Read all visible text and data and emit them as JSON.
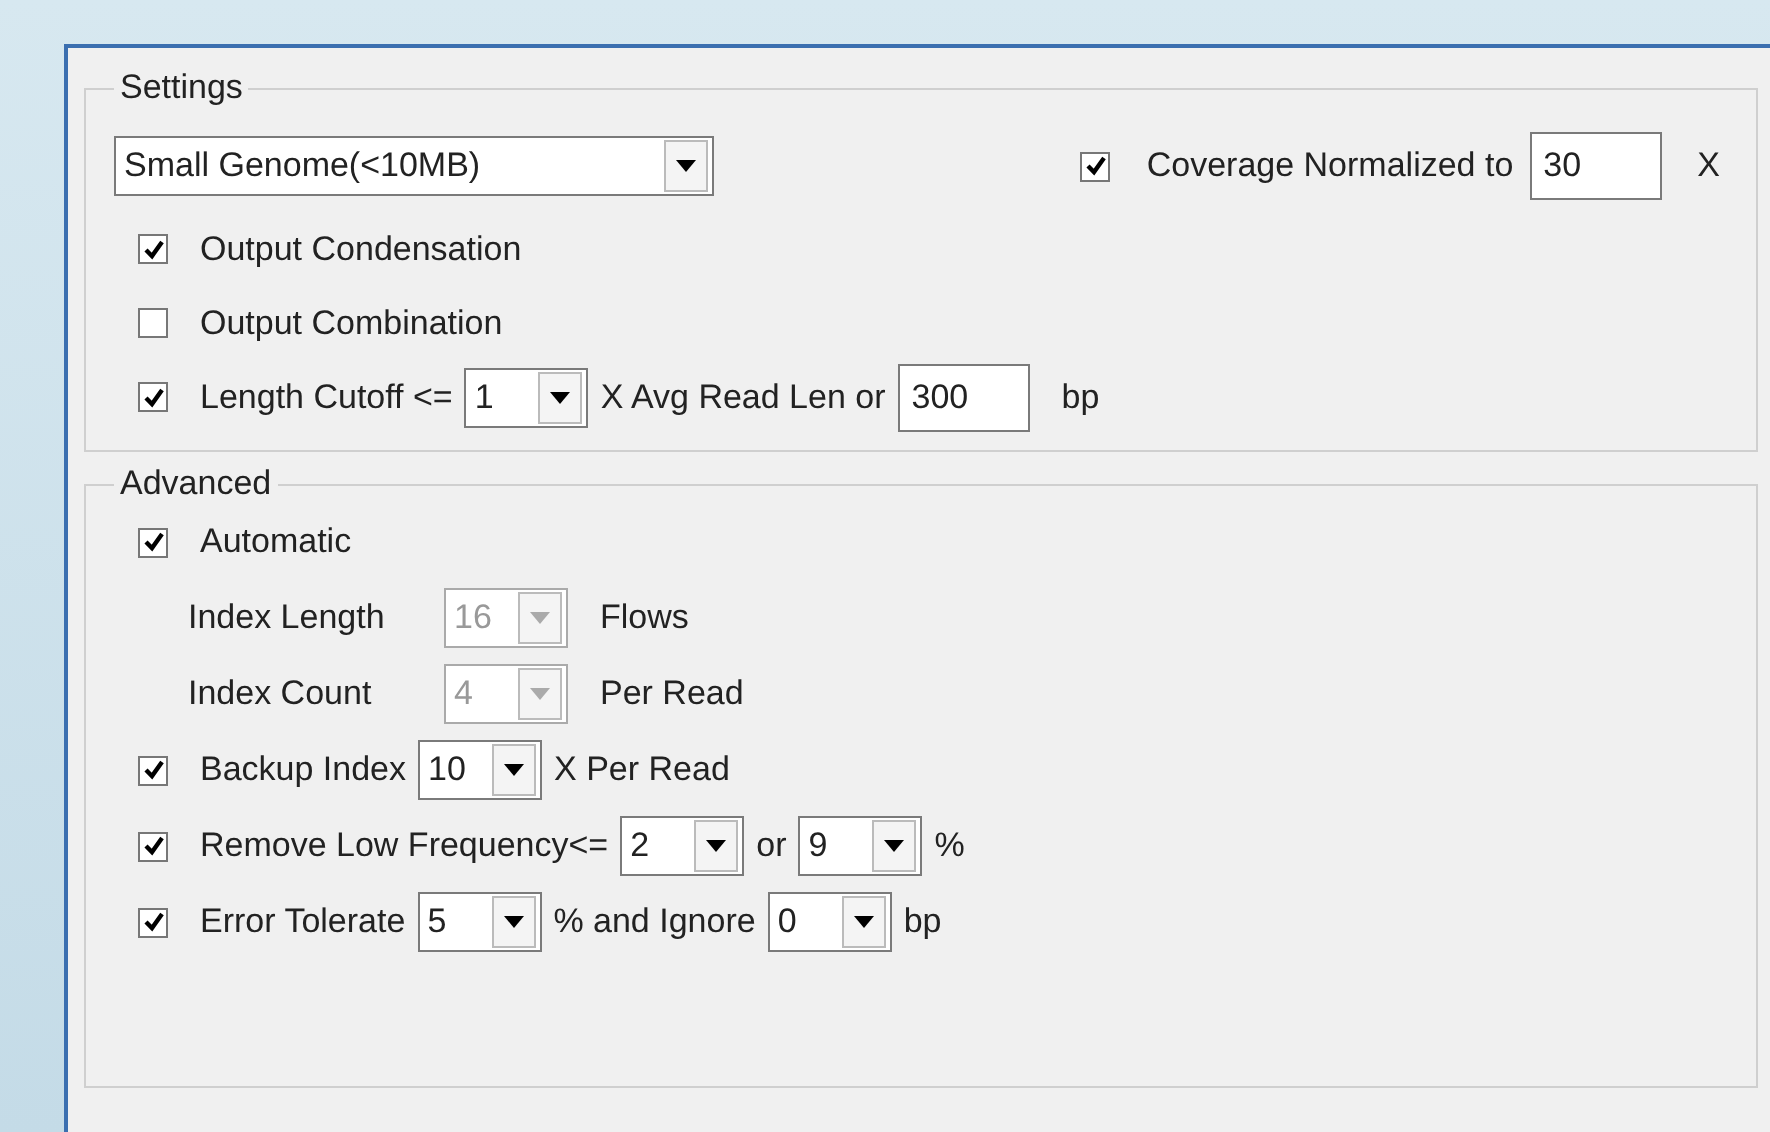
{
  "settings": {
    "title": "Settings",
    "preset": {
      "value": "Small Genome(<10MB)"
    },
    "coverage": {
      "checked": true,
      "label": "Coverage Normalized to",
      "value": "30",
      "unit": "X"
    },
    "rows": [
      {
        "kind": "check",
        "checked": true,
        "parts": [
          {
            "kind": "label",
            "text": "Output Condensation"
          }
        ]
      },
      {
        "kind": "check",
        "checked": false,
        "parts": [
          {
            "kind": "label",
            "text": "Output Combination"
          }
        ]
      },
      {
        "kind": "check",
        "checked": true,
        "parts": [
          {
            "kind": "label",
            "text": "Length Cutoff <="
          },
          {
            "kind": "select",
            "value": "1",
            "disabled": false
          },
          {
            "kind": "label",
            "text": "X Avg Read Len or"
          },
          {
            "kind": "input",
            "value": "300"
          },
          {
            "kind": "label",
            "text": "bp"
          }
        ]
      }
    ]
  },
  "advanced": {
    "title": "Advanced",
    "rows": [
      {
        "kind": "check",
        "checked": true,
        "parts": [
          {
            "kind": "label",
            "text": "Automatic"
          }
        ]
      },
      {
        "kind": "plain",
        "parts": [
          {
            "kind": "label",
            "text": "Index Length"
          },
          {
            "kind": "select",
            "value": "16",
            "disabled": true
          },
          {
            "kind": "label",
            "text": "Flows"
          }
        ]
      },
      {
        "kind": "plain",
        "parts": [
          {
            "kind": "label",
            "text": "Index Count"
          },
          {
            "kind": "select",
            "value": "4",
            "disabled": true
          },
          {
            "kind": "label",
            "text": "Per Read"
          }
        ]
      },
      {
        "kind": "check",
        "checked": true,
        "parts": [
          {
            "kind": "label",
            "text": "Backup Index"
          },
          {
            "kind": "select",
            "value": "10",
            "disabled": false
          },
          {
            "kind": "label",
            "text": "X Per Read"
          }
        ]
      },
      {
        "kind": "check",
        "checked": true,
        "parts": [
          {
            "kind": "label",
            "text": "Remove Low Frequency<="
          },
          {
            "kind": "select",
            "value": "2",
            "disabled": false
          },
          {
            "kind": "label",
            "text": "or"
          },
          {
            "kind": "select",
            "value": "9",
            "disabled": false
          },
          {
            "kind": "label",
            "text": "%"
          }
        ]
      },
      {
        "kind": "check",
        "checked": true,
        "parts": [
          {
            "kind": "label",
            "text": "Error Tolerate"
          },
          {
            "kind": "select",
            "value": "5",
            "disabled": false
          },
          {
            "kind": "label",
            "text": "% and Ignore"
          },
          {
            "kind": "select",
            "value": "0",
            "disabled": false
          },
          {
            "kind": "label",
            "text": "bp"
          }
        ]
      }
    ]
  }
}
